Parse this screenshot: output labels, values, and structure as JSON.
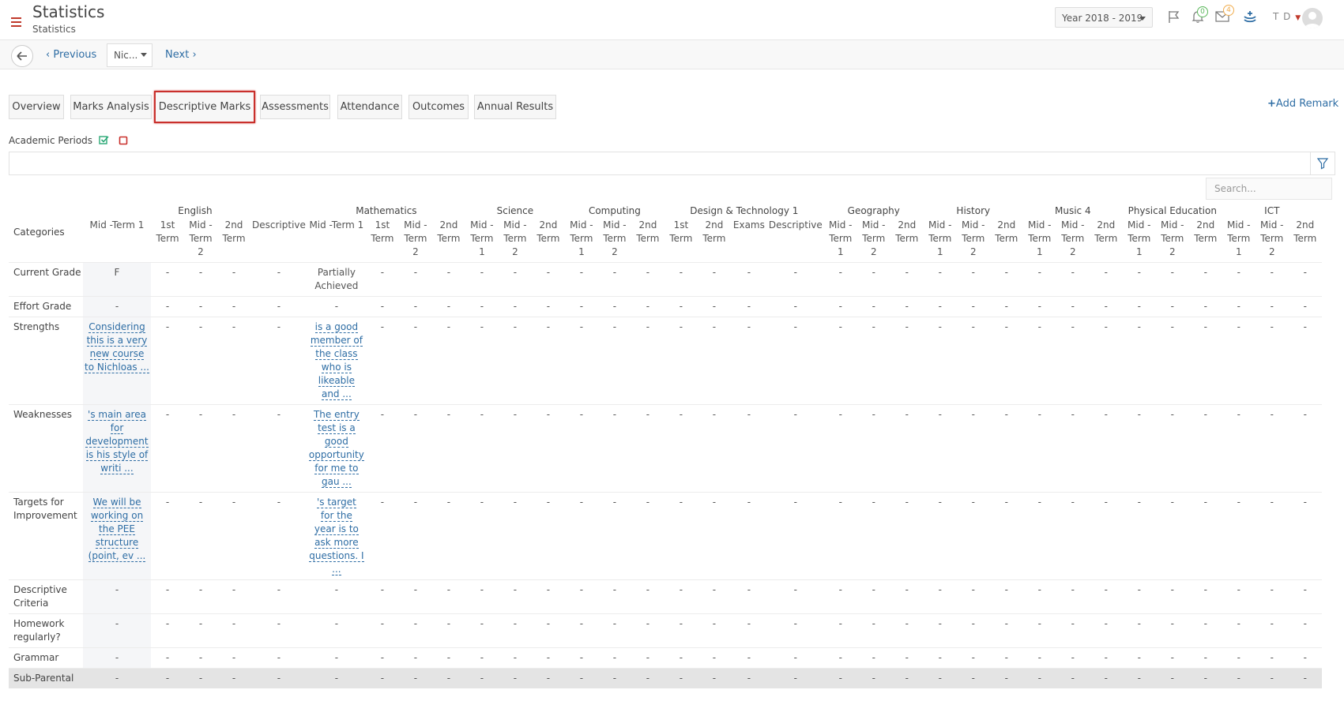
{
  "header": {
    "title": "Statistics",
    "subtitle": "Statistics",
    "year_select": "Year 2018 - 2019",
    "notifications_count": "0",
    "messages_count": "4",
    "user_initials": "T D",
    "colors": {
      "accent": "#c0392b",
      "link": "#2e6da4",
      "badge_green": "#5cb85c",
      "badge_orange": "#f0ad4e"
    }
  },
  "subnav": {
    "previous_label": "Previous",
    "next_label": "Next",
    "student_select": "Nic..."
  },
  "tabs": [
    {
      "label": "Overview",
      "active": false
    },
    {
      "label": "Marks Analysis",
      "active": false
    },
    {
      "label": "Descriptive Marks",
      "active": true
    },
    {
      "label": "Assessments",
      "active": false
    },
    {
      "label": "Attendance",
      "active": false
    },
    {
      "label": "Outcomes",
      "active": false
    },
    {
      "label": "Annual Results",
      "active": false
    }
  ],
  "add_remark_label": "Add Remark",
  "academic_periods_label": "Academic Periods",
  "search_placeholder": "Search...",
  "table": {
    "categories_header": "Categories",
    "subjects": [
      {
        "name": "English",
        "periods": [
          "Mid -Term 1",
          "1st Term",
          "Mid - Term 2",
          "2nd Term",
          "Descriptive"
        ]
      },
      {
        "name": "Mathematics",
        "periods": [
          "Mid -Term 1",
          "1st Term",
          "Mid - Term 2",
          "2nd Term"
        ]
      },
      {
        "name": "Science",
        "periods": [
          "Mid - Term 1",
          "Mid - Term 2",
          "2nd Term"
        ]
      },
      {
        "name": "Computing",
        "periods": [
          "Mid - Term 1",
          "Mid - Term 2",
          "2nd Term"
        ]
      },
      {
        "name": "Design & Technology 1",
        "periods": [
          "1st Term",
          "2nd Term",
          "Exams",
          "Descriptive"
        ]
      },
      {
        "name": "Geography",
        "periods": [
          "Mid - Term 1",
          "Mid - Term 2",
          "2nd Term"
        ]
      },
      {
        "name": "History",
        "periods": [
          "Mid - Term 1",
          "Mid - Term 2",
          "2nd Term"
        ]
      },
      {
        "name": "Music 4",
        "periods": [
          "Mid - Term 1",
          "Mid - Term 2",
          "2nd Term"
        ]
      },
      {
        "name": "Physical Education",
        "periods": [
          "Mid - Term 1",
          "Mid - Term 2",
          "2nd Term"
        ]
      },
      {
        "name": "ICT",
        "periods": [
          "Mid - Term 1",
          "Mid - Term 2",
          "2nd Term"
        ]
      }
    ],
    "rows": [
      {
        "category": "Current Grade",
        "special": {
          "0": "F",
          "5": "Partially Achieved"
        }
      },
      {
        "category": "Effort Grade",
        "special": {}
      },
      {
        "category": "Strengths",
        "links": {
          "0": "Considering this is a very new course to Nichloas ...",
          "5": "is a good member of the class who is likeable and ..."
        }
      },
      {
        "category": "Weaknesses",
        "links": {
          "0": "'s main area for development is his style of writi ...",
          "5": "The entry test is a good opportunity for me to gau ..."
        }
      },
      {
        "category": "Targets for Improvement",
        "links": {
          "0": "We will be working on the PEE structure (point, ev ...",
          "5": "'s target for the year is to ask more questions. I ..."
        }
      },
      {
        "category": "Descriptive Criteria",
        "special": {}
      },
      {
        "category": "Homework regularly?",
        "special": {}
      },
      {
        "category": "Grammar",
        "special": {}
      },
      {
        "category": "Sub-Parental",
        "special": {},
        "shade": true
      }
    ],
    "empty_value": "-"
  }
}
